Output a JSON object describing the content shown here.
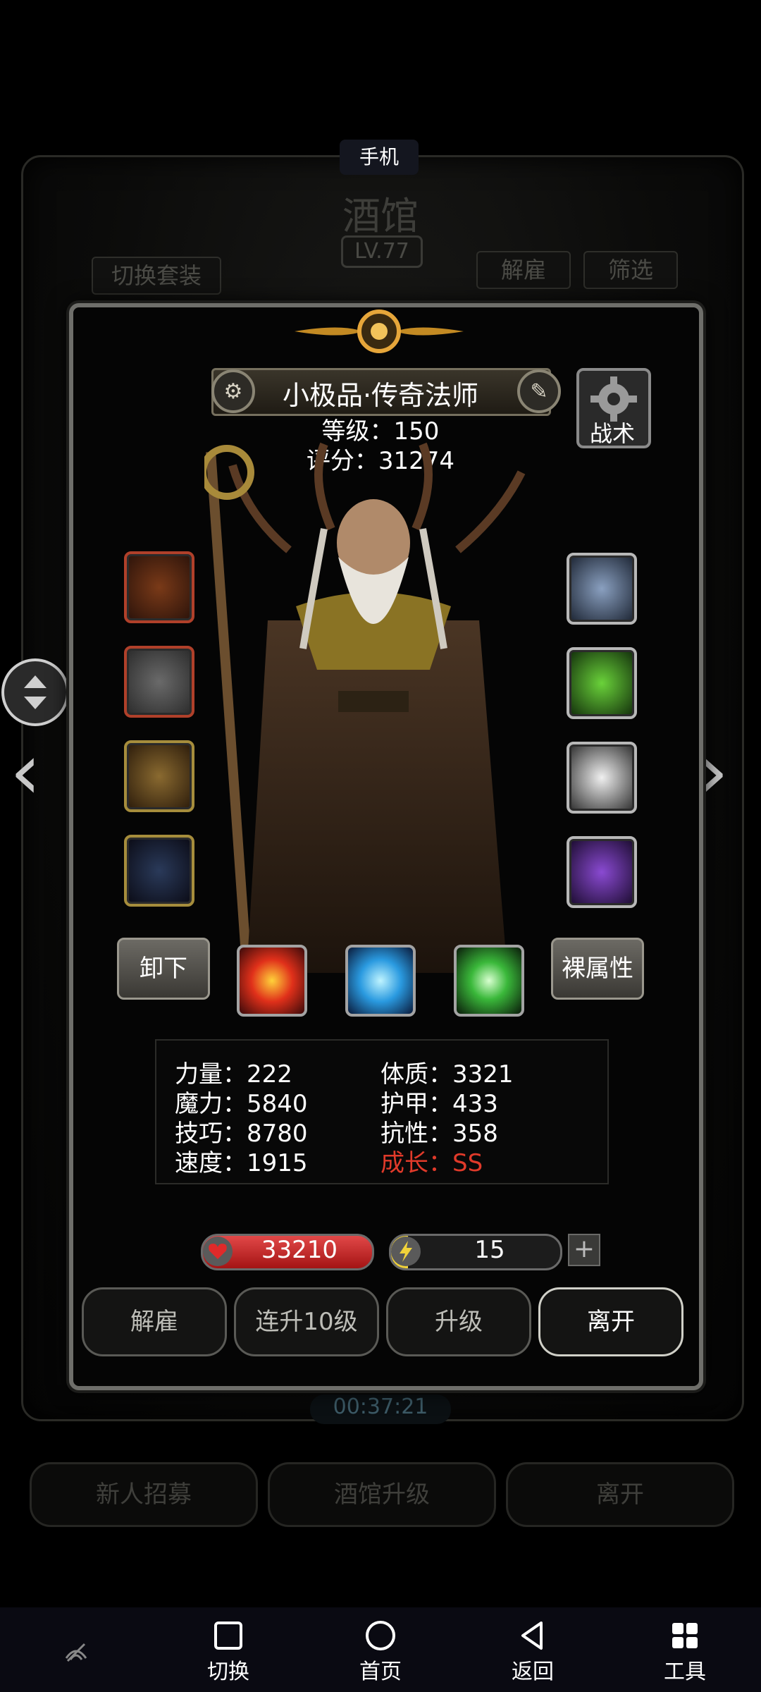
{
  "tooltip": "手机",
  "background": {
    "title": "酒馆",
    "level": "LV.77",
    "btn_switch_set": "切换套装",
    "btn_dismiss": "解雇",
    "btn_filter": "筛选",
    "timer": "00:37:21",
    "btn_recruit": "新人招募",
    "btn_upgrade_tavern": "酒馆升级",
    "btn_leave": "离开"
  },
  "hero": {
    "name": "小极品·传奇法师",
    "level_line": "等级：150",
    "score_line": "评分：31274",
    "tactics_label": "战术"
  },
  "buttons": {
    "unequip": "卸下",
    "base_attr": "裸属性"
  },
  "stats": {
    "left": [
      "力量：222",
      "魔力：5840",
      "技巧：8780",
      "速度：1915"
    ],
    "right": [
      "体质：3321",
      "护甲：433",
      "抗性：358"
    ],
    "growth": "成长：SS"
  },
  "hp": "33210",
  "energy": "15",
  "energy_fill": 0.1,
  "actions": [
    "解雇",
    "连升10级",
    "升级",
    "离开"
  ],
  "nav": [
    {
      "label": "切换",
      "icon": "square-icon"
    },
    {
      "label": "首页",
      "icon": "circle-icon"
    },
    {
      "label": "返回",
      "icon": "back-triangle-icon"
    },
    {
      "label": "工具",
      "icon": "grid-icon"
    }
  ],
  "colors": {
    "growth": "#e03a2a",
    "hp": "#c72020",
    "energy": "#f0d23a"
  }
}
